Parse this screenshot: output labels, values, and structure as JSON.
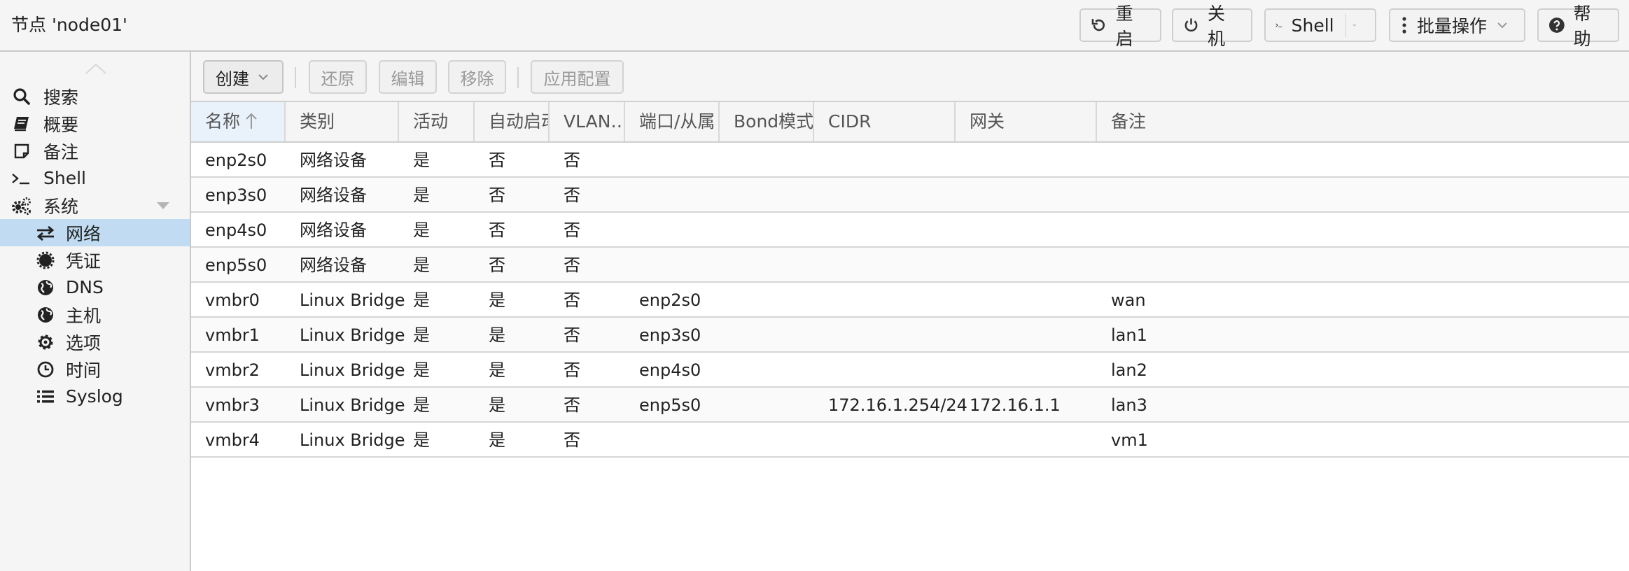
{
  "header": {
    "title": "节点 'node01'",
    "buttons": {
      "reboot": "重启",
      "shutdown": "关机",
      "shell": "Shell",
      "bulk": "批量操作",
      "help": "帮助"
    }
  },
  "sidebar": {
    "items": [
      {
        "label": "搜索",
        "icon": "search-icon"
      },
      {
        "label": "概要",
        "icon": "book-icon"
      },
      {
        "label": "备注",
        "icon": "sticky-note-icon"
      },
      {
        "label": "Shell",
        "icon": "terminal-icon"
      },
      {
        "label": "系统",
        "icon": "cogs-icon"
      },
      {
        "label": "网络",
        "icon": "exchange-icon",
        "selected": true
      },
      {
        "label": "凭证",
        "icon": "certificate-icon"
      },
      {
        "label": "DNS",
        "icon": "globe-icon"
      },
      {
        "label": "主机",
        "icon": "globe-icon"
      },
      {
        "label": "选项",
        "icon": "gear-icon"
      },
      {
        "label": "时间",
        "icon": "clock-icon"
      },
      {
        "label": "Syslog",
        "icon": "list-icon"
      }
    ]
  },
  "toolbar": {
    "create": "创建",
    "revert": "还原",
    "edit": "编辑",
    "remove": "移除",
    "apply": "应用配置"
  },
  "table": {
    "columns": [
      "名称",
      "类别",
      "活动",
      "自动启动",
      "VLAN…",
      "端口/从属",
      "Bond模式",
      "CIDR",
      "网关",
      "备注"
    ],
    "rows": [
      [
        "enp2s0",
        "网络设备",
        "是",
        "否",
        "否",
        "",
        "",
        "",
        "",
        ""
      ],
      [
        "enp3s0",
        "网络设备",
        "是",
        "否",
        "否",
        "",
        "",
        "",
        "",
        ""
      ],
      [
        "enp4s0",
        "网络设备",
        "是",
        "否",
        "否",
        "",
        "",
        "",
        "",
        ""
      ],
      [
        "enp5s0",
        "网络设备",
        "是",
        "否",
        "否",
        "",
        "",
        "",
        "",
        ""
      ],
      [
        "vmbr0",
        "Linux Bridge",
        "是",
        "是",
        "否",
        "enp2s0",
        "",
        "",
        "",
        "wan"
      ],
      [
        "vmbr1",
        "Linux Bridge",
        "是",
        "是",
        "否",
        "enp3s0",
        "",
        "",
        "",
        "lan1"
      ],
      [
        "vmbr2",
        "Linux Bridge",
        "是",
        "是",
        "否",
        "enp4s0",
        "",
        "",
        "",
        "lan2"
      ],
      [
        "vmbr3",
        "Linux Bridge",
        "是",
        "是",
        "否",
        "enp5s0",
        "",
        "172.16.1.254/24",
        "172.16.1.1",
        "lan3"
      ],
      [
        "vmbr4",
        "Linux Bridge",
        "是",
        "是",
        "否",
        "",
        "",
        "",
        "",
        "vm1"
      ]
    ]
  }
}
